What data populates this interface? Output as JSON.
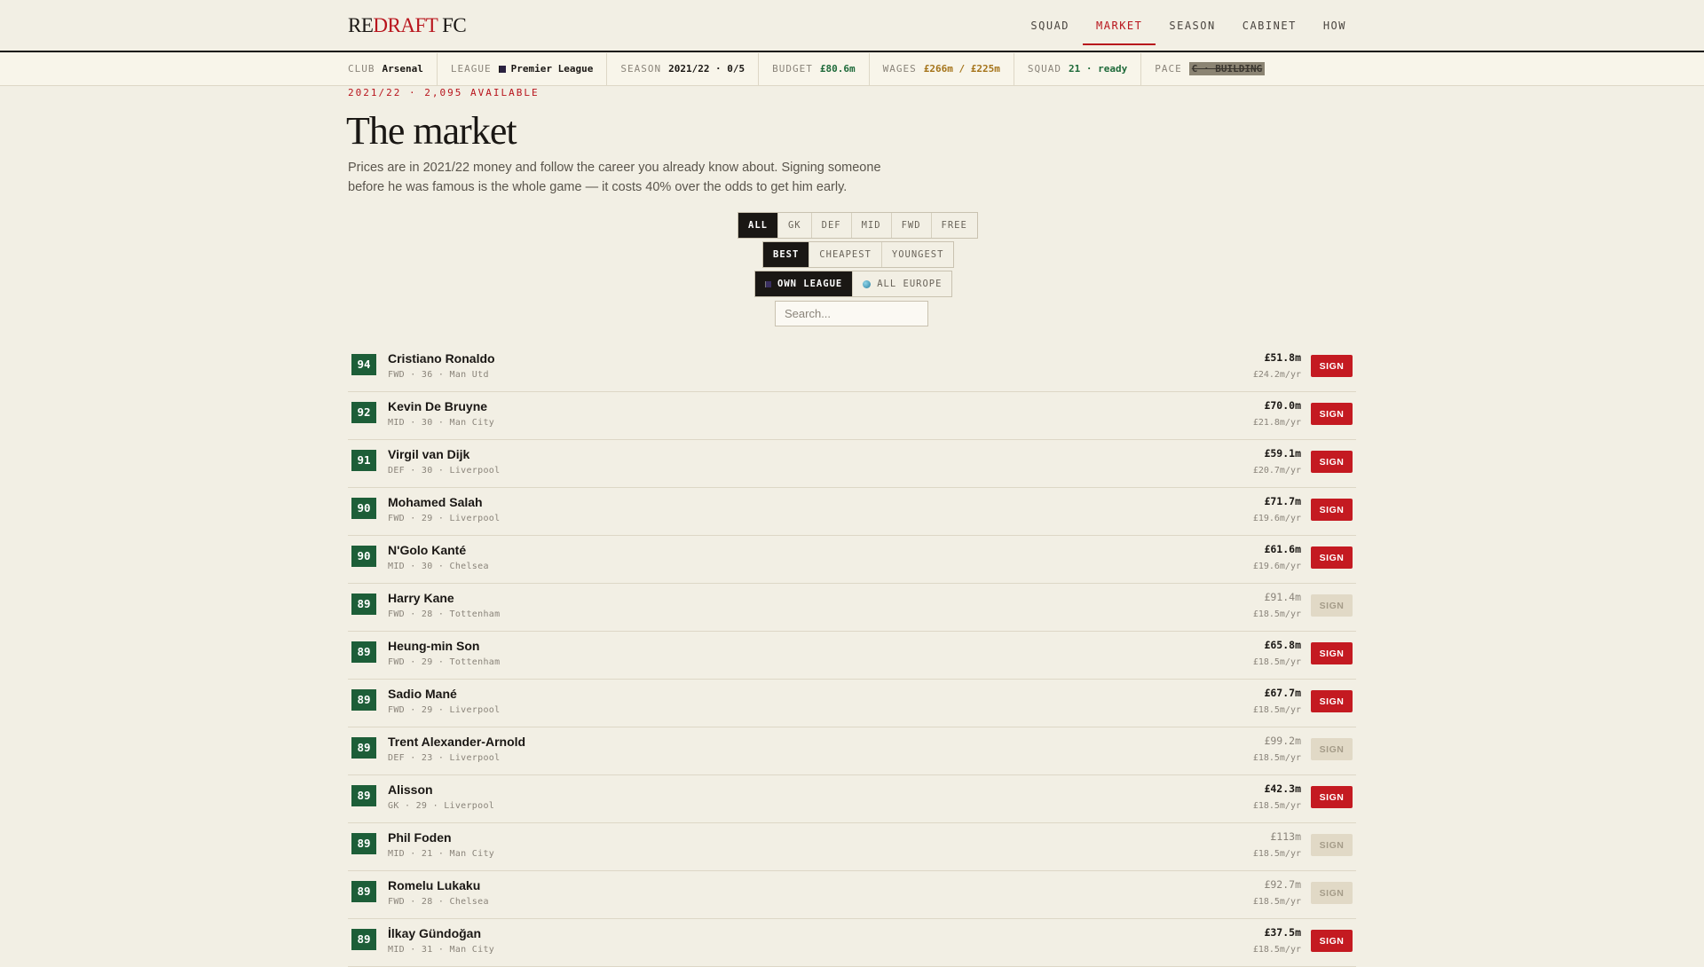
{
  "brand": {
    "part1": "RE",
    "part2": "DRAFT",
    "part3": " FC"
  },
  "nav": [
    {
      "label": "SQUAD",
      "active": false
    },
    {
      "label": "MARKET",
      "active": true
    },
    {
      "label": "SEASON",
      "active": false
    },
    {
      "label": "CABINET",
      "active": false
    },
    {
      "label": "HOW",
      "active": false
    }
  ],
  "status": {
    "club_label": "CLUB",
    "club": "Arsenal",
    "league_label": "LEAGUE",
    "league": "Premier League",
    "season_label": "SEASON",
    "season": "2021/22 · 0/5",
    "budget_label": "BUDGET",
    "budget": "£80.6m",
    "wages_label": "WAGES",
    "wages": "£266m / £225m",
    "squad_label": "SQUAD",
    "squad": "21 · ready",
    "pace_label": "PACE",
    "pace": "C · BUILDING"
  },
  "header": {
    "eyebrow": "2021/22 · 2,095 AVAILABLE",
    "title": "The market",
    "intro": "Prices are in 2021/22 money and follow the career you already know about. Signing someone before he was famous is the whole game — it costs 40% over the odds to get him early."
  },
  "filters": {
    "position": [
      "ALL",
      "GK",
      "DEF",
      "MID",
      "FWD",
      "FREE"
    ],
    "sort": [
      "BEST",
      "CHEAPEST",
      "YOUNGEST"
    ],
    "scope": [
      "OWN LEAGUE",
      "ALL EUROPE"
    ],
    "search_placeholder": "Search..."
  },
  "sign_label": "SIGN",
  "players": [
    {
      "rating": "94",
      "name": "Cristiano Ronaldo",
      "meta": "FWD · 36 · Man Utd",
      "price": "£51.8m",
      "wage": "£24.2m/yr",
      "available": true
    },
    {
      "rating": "92",
      "name": "Kevin De Bruyne",
      "meta": "MID · 30 · Man City",
      "price": "£70.0m",
      "wage": "£21.8m/yr",
      "available": true
    },
    {
      "rating": "91",
      "name": "Virgil van Dijk",
      "meta": "DEF · 30 · Liverpool",
      "price": "£59.1m",
      "wage": "£20.7m/yr",
      "available": true
    },
    {
      "rating": "90",
      "name": "Mohamed Salah",
      "meta": "FWD · 29 · Liverpool",
      "price": "£71.7m",
      "wage": "£19.6m/yr",
      "available": true
    },
    {
      "rating": "90",
      "name": "N'Golo Kanté",
      "meta": "MID · 30 · Chelsea",
      "price": "£61.6m",
      "wage": "£19.6m/yr",
      "available": true
    },
    {
      "rating": "89",
      "name": "Harry Kane",
      "meta": "FWD · 28 · Tottenham",
      "price": "£91.4m",
      "wage": "£18.5m/yr",
      "available": false
    },
    {
      "rating": "89",
      "name": "Heung-min Son",
      "meta": "FWD · 29 · Tottenham",
      "price": "£65.8m",
      "wage": "£18.5m/yr",
      "available": true
    },
    {
      "rating": "89",
      "name": "Sadio Mané",
      "meta": "FWD · 29 · Liverpool",
      "price": "£67.7m",
      "wage": "£18.5m/yr",
      "available": true
    },
    {
      "rating": "89",
      "name": "Trent Alexander-Arnold",
      "meta": "DEF · 23 · Liverpool",
      "price": "£99.2m",
      "wage": "£18.5m/yr",
      "available": false
    },
    {
      "rating": "89",
      "name": "Alisson",
      "meta": "GK · 29 · Liverpool",
      "price": "£42.3m",
      "wage": "£18.5m/yr",
      "available": true
    },
    {
      "rating": "89",
      "name": "Phil Foden",
      "meta": "MID · 21 · Man City",
      "price": "£113m",
      "wage": "£18.5m/yr",
      "available": false
    },
    {
      "rating": "89",
      "name": "Romelu Lukaku",
      "meta": "FWD · 28 · Chelsea",
      "price": "£92.7m",
      "wage": "£18.5m/yr",
      "available": false
    },
    {
      "rating": "89",
      "name": "İlkay Gündoğan",
      "meta": "MID · 31 · Man City",
      "price": "£37.5m",
      "wage": "£18.5m/yr",
      "available": true
    }
  ]
}
